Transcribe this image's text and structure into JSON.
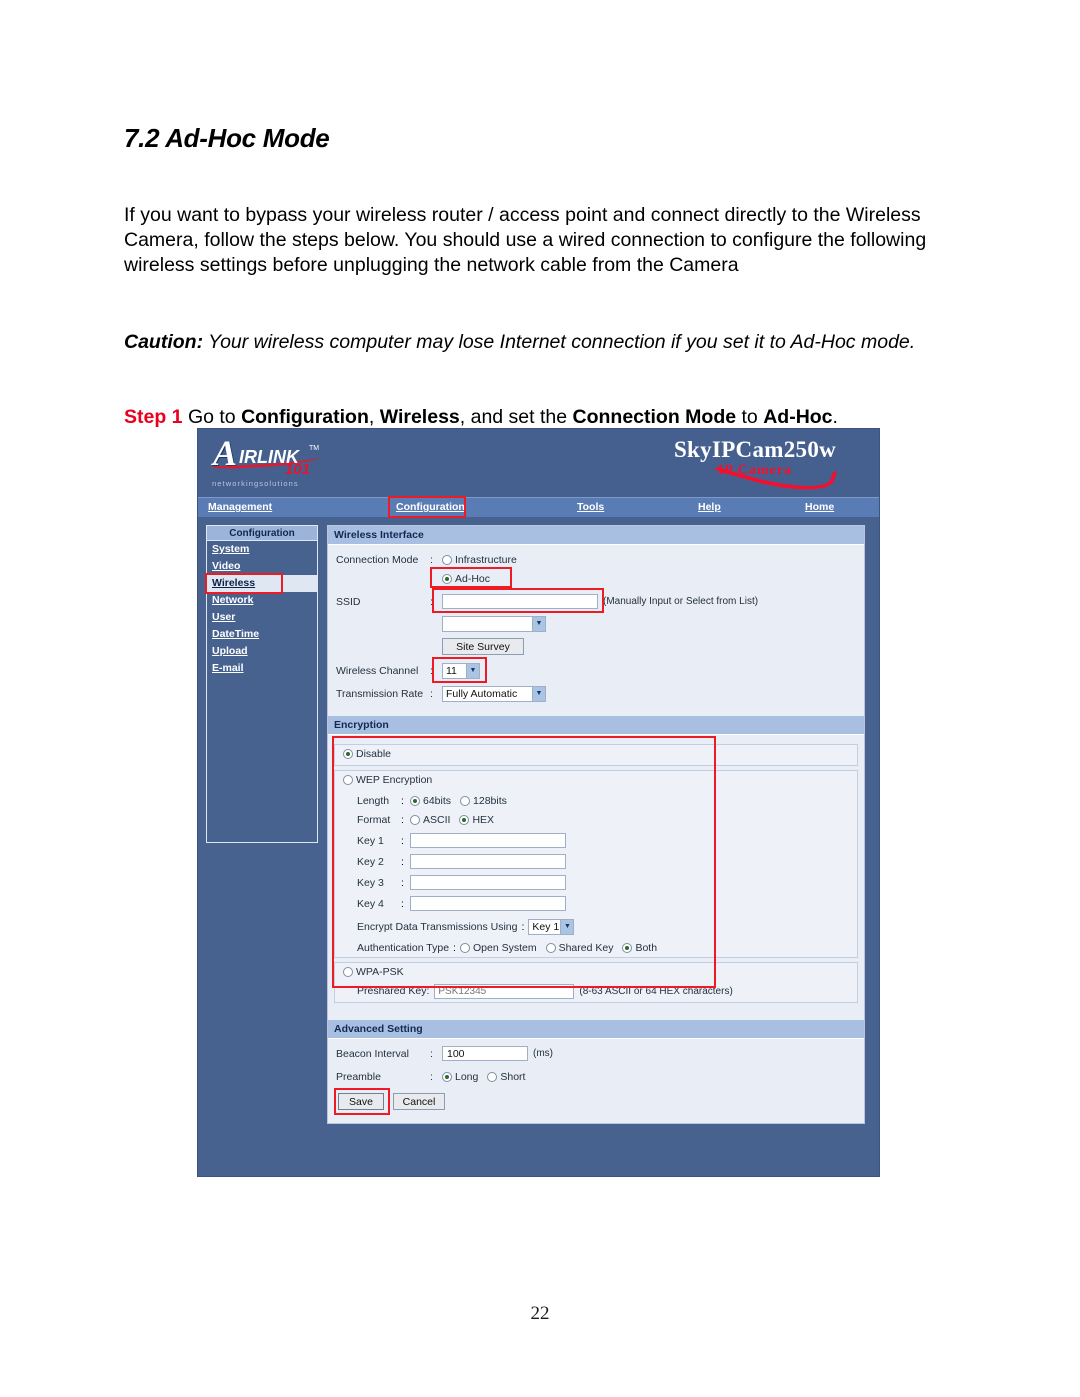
{
  "document": {
    "heading": "7.2 Ad-Hoc Mode",
    "paragraph": "If you want to bypass your wireless router / access point and connect directly to the Wireless Camera, follow the steps below. You should use a wired connection to configure the following wireless settings before unplugging the network cable from the Camera",
    "caution_label": "Caution:",
    "caution_text": " Your wireless computer may lose Internet connection if you set it to Ad-Hoc mode.",
    "step_label": "Step 1",
    "step_text_1": " Go to ",
    "step_bold_1": "Configuration",
    "step_text_2": ", ",
    "step_bold_2": "Wireless",
    "step_text_3": ", and set the ",
    "step_bold_3": "Connection Mode",
    "step_text_4": " to ",
    "step_bold_4": "Ad-Hoc",
    "step_text_5": ".",
    "page_number": "22"
  },
  "screenshot": {
    "brand": {
      "logo_letter": "A",
      "logo_rest": "IRLINK",
      "logo_tm": "TM",
      "logo_101": "101",
      "logo_tagline": "networkingsolutions",
      "product_name": "SkyIPCam250w",
      "product_sub": "IP Camera"
    },
    "nav": [
      {
        "label": "Management"
      },
      {
        "label": "Configuration"
      },
      {
        "label": "Tools"
      },
      {
        "label": "Help"
      },
      {
        "label": "Home"
      }
    ],
    "sidebar": {
      "title": "Configuration",
      "items": [
        {
          "label": "System",
          "active": false
        },
        {
          "label": "Video",
          "active": false
        },
        {
          "label": "Wireless",
          "active": true
        },
        {
          "label": "Network",
          "active": false
        },
        {
          "label": "User",
          "active": false
        },
        {
          "label": "DateTime",
          "active": false
        },
        {
          "label": "Upload",
          "active": false
        },
        {
          "label": "E-mail",
          "active": false
        }
      ]
    },
    "wireless_interface": {
      "section_title": "Wireless Interface",
      "connection_mode_label": "Connection Mode",
      "mode_infrastructure": "Infrastructure",
      "mode_adhoc": "Ad-Hoc",
      "ssid_label": "SSID",
      "ssid_value": "",
      "ssid_note": "(Manually Input or Select from List)",
      "ssid_select_value": "",
      "site_survey_button": "Site Survey",
      "wireless_channel_label": "Wireless Channel",
      "wireless_channel_value": "11",
      "transmission_rate_label": "Transmission Rate",
      "transmission_rate_value": "Fully Automatic"
    },
    "encryption": {
      "section_title": "Encryption",
      "disable_label": "Disable",
      "wep_label": "WEP Encryption",
      "length_label": "Length",
      "length_64": "64bits",
      "length_128": "128bits",
      "format_label": "Format",
      "format_ascii": "ASCII",
      "format_hex": "HEX",
      "key1_label": "Key 1",
      "key2_label": "Key 2",
      "key3_label": "Key 3",
      "key4_label": "Key 4",
      "key1_value": "",
      "key2_value": "",
      "key3_value": "",
      "key4_value": "",
      "encrypt_using_label": "Encrypt Data Transmissions Using",
      "encrypt_using_value": "Key 1",
      "auth_type_label": "Authentication Type",
      "auth_open": "Open System",
      "auth_shared": "Shared Key",
      "auth_both": "Both",
      "wpa_label": "WPA-PSK",
      "preshared_key_label": "Preshared Key:",
      "preshared_key_placeholder": "PSK12345",
      "preshared_key_note": "(8-63 ASCII or 64 HEX characters)"
    },
    "advanced": {
      "section_title": "Advanced Setting",
      "beacon_label": "Beacon Interval",
      "beacon_value": "100",
      "beacon_unit": "(ms)",
      "preamble_label": "Preamble",
      "preamble_long": "Long",
      "preamble_short": "Short"
    },
    "buttons": {
      "save": "Save",
      "cancel": "Cancel"
    },
    "colors": {
      "highlight": "#ee1b24",
      "chrome_blue": "#45608e",
      "nav_blue": "#5a7cb5",
      "section_header": "#a9bfe2",
      "accent_red": "#e4162b"
    }
  }
}
